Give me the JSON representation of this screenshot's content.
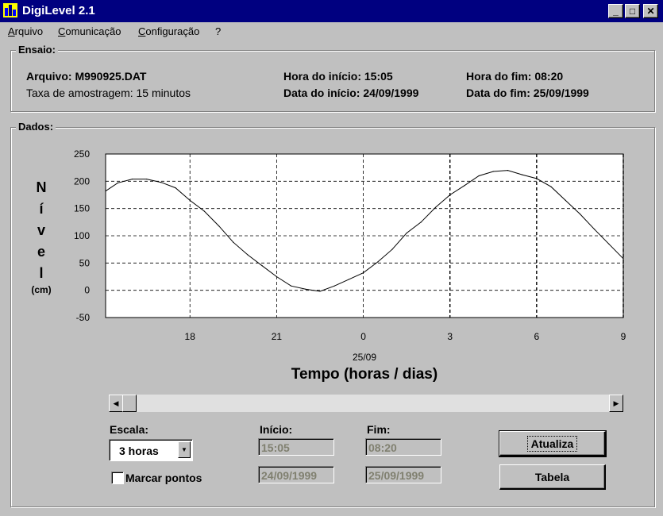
{
  "window": {
    "title": "DigiLevel 2.1"
  },
  "caption_buttons": {
    "minimize": "_",
    "maximize": "□",
    "close": "✕"
  },
  "menu": [
    {
      "label": "Arquivo"
    },
    {
      "label": "Comunicação"
    },
    {
      "label": "Configuração"
    },
    {
      "label": "?"
    }
  ],
  "ensaio": {
    "label": "Ensaio:",
    "arquivo": "Arquivo:  M990925.DAT",
    "taxa": "Taxa  de amostragem:  15 minutos",
    "hora_inicio": "Hora do início: 15:05",
    "data_inicio": "Data do início: 24/09/1999",
    "hora_fim": "Hora do fim: 08:20",
    "data_fim": "Data do fim: 25/09/1999"
  },
  "dados": {
    "label": "Dados:"
  },
  "chart_data": {
    "type": "line",
    "ylabel_letters": [
      "N",
      "í",
      "v",
      "e",
      "l"
    ],
    "ylabel_unit": "(cm)",
    "xlabel": "Tempo (horas / dias)",
    "date_label": "25/09",
    "ylim": [
      -50,
      250
    ],
    "yticks": [
      250,
      200,
      150,
      100,
      50,
      0,
      -50
    ],
    "xlim_hours": [
      15.08,
      33
    ],
    "xticks": [
      {
        "hour": 18,
        "label": "18"
      },
      {
        "hour": 21,
        "label": "21"
      },
      {
        "hour": 24,
        "label": "0"
      },
      {
        "hour": 27,
        "label": "3"
      },
      {
        "hour": 30,
        "label": "6"
      },
      {
        "hour": 33,
        "label": "9"
      }
    ],
    "grid": true,
    "series": [
      {
        "color": "#000000",
        "x": [
          15.08,
          15.5,
          16,
          16.5,
          17,
          17.5,
          18,
          18.5,
          19,
          19.5,
          20,
          20.5,
          21,
          21.5,
          22,
          22.5,
          23,
          23.5,
          24,
          24.5,
          25,
          25.5,
          26,
          26.5,
          27,
          27.5,
          28,
          28.5,
          29,
          29.5,
          30,
          30.5,
          31,
          31.5,
          32,
          32.5,
          33
        ],
        "y": [
          182,
          197,
          204,
          204,
          198,
          188,
          165,
          145,
          118,
          88,
          65,
          45,
          25,
          8,
          2,
          -2,
          8,
          20,
          32,
          52,
          75,
          105,
          125,
          152,
          175,
          192,
          210,
          218,
          220,
          212,
          205,
          190,
          165,
          140,
          112,
          85,
          58
        ]
      }
    ]
  },
  "controls": {
    "escala_label": "Escala:",
    "escala_value": "3 horas",
    "inicio_label": "Início:",
    "inicio_time": "15:05",
    "inicio_date": "24/09/1999",
    "fim_label": "Fim:",
    "fim_time": "08:20",
    "fim_date": "25/09/1999",
    "marcar_label": "Marcar pontos",
    "marcar_checked": false,
    "atualiza_label": "Atualiza",
    "tabela_label": "Tabela"
  }
}
